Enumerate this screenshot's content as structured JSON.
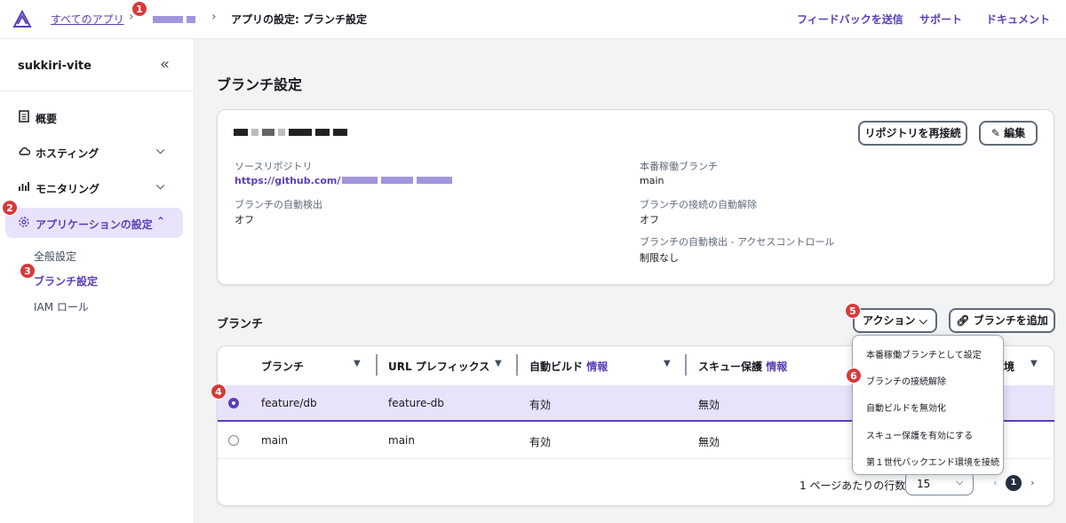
{
  "header": {
    "crumb_all_apps": "すべてのアプリ",
    "crumb_current": "アプリの設定: ブランチ設定",
    "links": [
      "フィードバックを送信",
      "サポート",
      "ドキュメント"
    ]
  },
  "badges": [
    "1",
    "2",
    "3",
    "4",
    "5",
    "6"
  ],
  "sidebar": {
    "app_name": "sukkiri-vite",
    "items": [
      {
        "label": "概要"
      },
      {
        "label": "ホスティング"
      },
      {
        "label": "モニタリング"
      },
      {
        "label": "アプリケーションの設定"
      }
    ],
    "sub_items": [
      {
        "label": "全般設定"
      },
      {
        "label": "ブランチ設定"
      },
      {
        "label": "IAM ロール"
      }
    ]
  },
  "main": {
    "title": "ブランチ設定",
    "repo_card": {
      "reconnect_label": "リポジトリを再接続",
      "edit_label": "編集",
      "source_repo_label": "ソースリポジトリ",
      "source_repo_value": "https://github.com/",
      "auto_detect_label": "ブランチの自動検出",
      "auto_detect_value": "オフ",
      "prod_branch_label": "本番稼働ブランチ",
      "prod_branch_value": "main",
      "auto_disconnect_label": "ブランチの接続の自動解除",
      "auto_disconnect_value": "オフ",
      "access_control_label": "ブランチの自動検出 - アクセスコントロール",
      "access_control_value": "制限なし"
    },
    "branches": {
      "title": "ブランチ",
      "actions_label": "アクション",
      "add_label": "ブランチを追加",
      "columns": {
        "branch": "ブランチ",
        "url_prefix": "URL プレフィックス",
        "auto_build": "自動ビルド",
        "skew": "スキュー保護",
        "info": "情報",
        "env_tail": "境"
      },
      "rows": [
        {
          "branch": "feature/db",
          "prefix": "feature-db",
          "auto_build": "有効",
          "skew": "無効",
          "selected": true
        },
        {
          "branch": "main",
          "prefix": "main",
          "auto_build": "有効",
          "skew": "無効",
          "selected": false
        }
      ],
      "menu": [
        "本番稼働ブランチとして設定",
        "ブランチの接続解除",
        "自動ビルドを無効化",
        "スキュー保護を有効にする",
        "第１世代バックエンド環境を接続"
      ],
      "pager": {
        "rows_per_page_label": "1 ページあたりの行数",
        "rows_per_page": "15",
        "current_page": "1"
      }
    }
  },
  "colors": {
    "accent": "#5a3fb8",
    "selected_row": "#e8e2fb",
    "badge": "#d63a3a"
  }
}
